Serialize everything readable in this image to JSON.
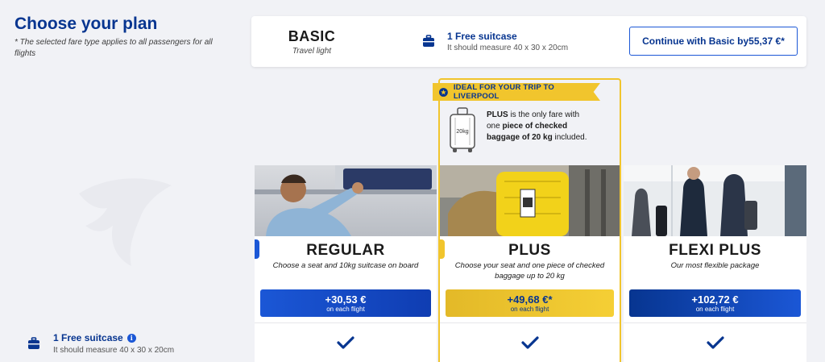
{
  "header": {
    "title": "Choose your plan",
    "note": "*  The selected fare type applies to all passengers for all flights"
  },
  "basic": {
    "name": "BASIC",
    "subtitle": "Travel light",
    "feature_title": "1 Free suitcase",
    "feature_desc": "It should measure 40 x 30 x 20cm",
    "continue_label": "Continue with Basic by55,37 €*"
  },
  "ribbon": {
    "text": "IDEAL FOR YOUR TRIP TO LIVERPOOL"
  },
  "plus_info": {
    "weight_label": "20kg",
    "p1": "PLUS",
    "p2": " is the only fare with one ",
    "p3": "piece of checked baggage of 20 kg",
    "p4": " included."
  },
  "plans": [
    {
      "name": "REGULAR",
      "subtitle": "Choose a seat and 10kg suitcase on board",
      "price": "+30,53 €",
      "price_sub": "on each flight",
      "color": "#1b57d6",
      "tab_color": "#1b57d6"
    },
    {
      "name": "PLUS",
      "subtitle": "Choose your seat and one piece of checked baggage up to 20 kg",
      "price": "+49,68 €*",
      "price_sub": "on each flight",
      "color": "#f1c52d",
      "tab_color": "#f1c52d"
    },
    {
      "name": "FLEXI PLUS",
      "subtitle": "Our most flexible package",
      "price": "+102,72 €",
      "price_sub": "on each flight",
      "color": "#073590"
    }
  ],
  "feature": {
    "title": "1 Free suitcase",
    "info_symbol": "i",
    "desc": "It should measure 40 x 30 x 20cm"
  },
  "icons": [
    "suitcase-icon",
    "star-icon",
    "checkmark-icon",
    "info-icon",
    "harp-logo"
  ],
  "colors": {
    "brand_blue": "#073590",
    "accent_blue": "#1b57d6",
    "yellow": "#f1c52d",
    "background": "#f1f2f6"
  }
}
